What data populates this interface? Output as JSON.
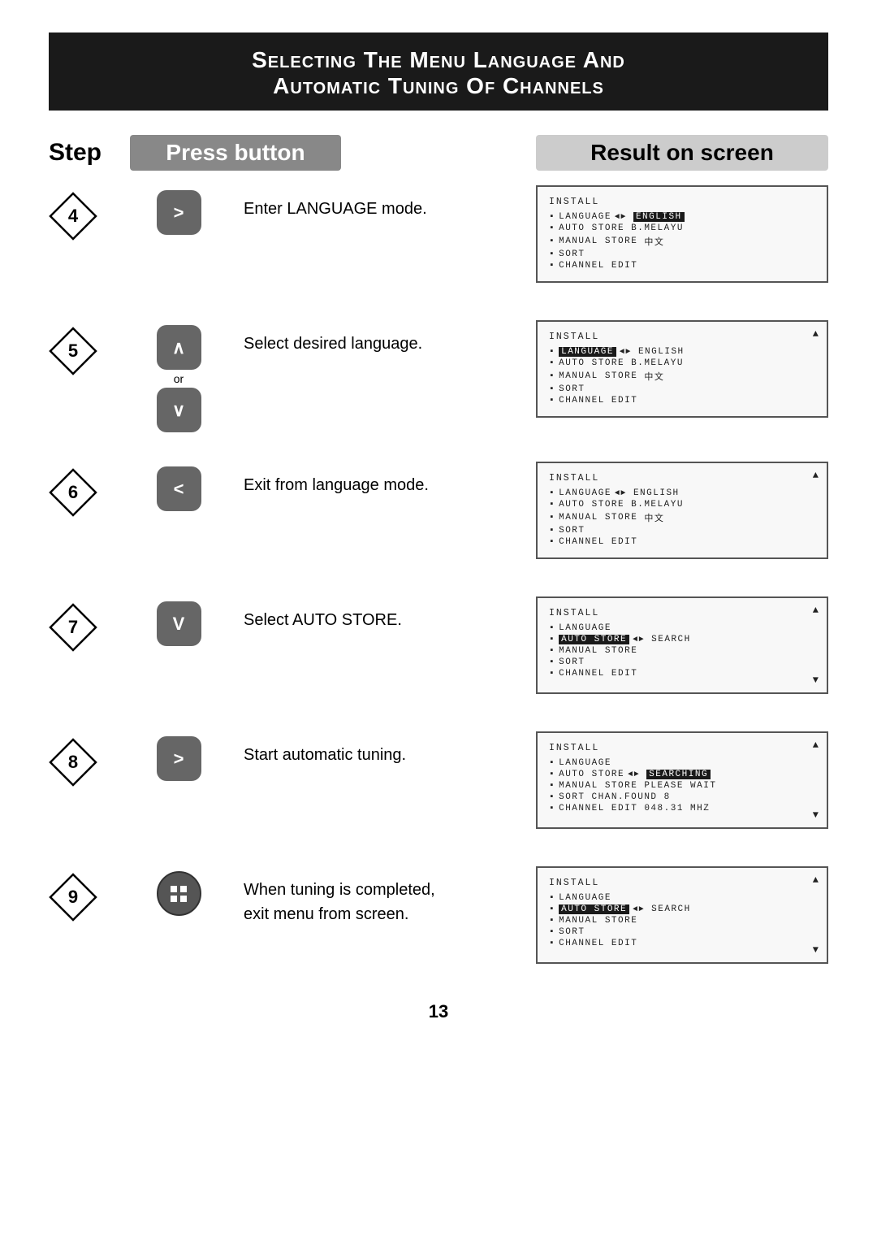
{
  "title": {
    "line1": "Selecting The Menu Language And",
    "line2": "Automatic Tuning Of Channels"
  },
  "headers": {
    "step": "Step",
    "press": "Press button",
    "result": "Result on screen"
  },
  "steps": [
    {
      "num": "4",
      "button": "right",
      "button_label": ">",
      "description": "Enter LANGUAGE mode.",
      "screen": {
        "title": "INSTALL",
        "arrow_up": false,
        "arrow_down": false,
        "rows": [
          {
            "bullet": true,
            "text": "LANGUAGE",
            "highlight": false,
            "right": "ENGLISH",
            "right_highlight": true,
            "arrow": true
          },
          {
            "bullet": true,
            "text": "AUTO STORE",
            "highlight": false,
            "right": "B.MELAYU",
            "right_highlight": false,
            "arrow": false
          },
          {
            "bullet": true,
            "text": "MANUAL STORE",
            "highlight": false,
            "right": "中文",
            "right_highlight": false,
            "arrow": false
          },
          {
            "bullet": true,
            "text": "SORT",
            "highlight": false,
            "right": "",
            "right_highlight": false,
            "arrow": false
          },
          {
            "bullet": true,
            "text": "CHANNEL EDIT",
            "highlight": false,
            "right": "",
            "right_highlight": false,
            "arrow": false
          }
        ]
      }
    },
    {
      "num": "5",
      "button": "up_down",
      "button_label_up": "∧",
      "button_label_down": "∨",
      "description": "Select desired language.",
      "screen": {
        "title": "INSTALL",
        "arrow_up": true,
        "arrow_down": false,
        "rows": [
          {
            "bullet": true,
            "text": "LANGUAGE",
            "highlight": true,
            "right": "ENGLISH",
            "right_highlight": false,
            "arrow": true
          },
          {
            "bullet": true,
            "text": "AUTO STORE",
            "highlight": false,
            "right": "B.MELAYU",
            "right_highlight": false,
            "arrow": false
          },
          {
            "bullet": true,
            "text": "MANUAL STORE",
            "highlight": false,
            "right": "中文",
            "right_highlight": false,
            "arrow": false
          },
          {
            "bullet": true,
            "text": "SORT",
            "highlight": false,
            "right": "",
            "right_highlight": false,
            "arrow": false
          },
          {
            "bullet": true,
            "text": "CHANNEL EDIT",
            "highlight": false,
            "right": "",
            "right_highlight": false,
            "arrow": false
          }
        ]
      }
    },
    {
      "num": "6",
      "button": "left",
      "button_label": "<",
      "description": "Exit from language mode.",
      "screen": {
        "title": "INSTALL",
        "arrow_up": true,
        "arrow_down": false,
        "rows": [
          {
            "bullet": true,
            "text": "LANGUAGE",
            "highlight": false,
            "right": "ENGLISH",
            "right_highlight": false,
            "arrow": true
          },
          {
            "bullet": true,
            "text": "AUTO STORE",
            "highlight": false,
            "right": "B.MELAYU",
            "right_highlight": false,
            "arrow": false
          },
          {
            "bullet": true,
            "text": "MANUAL STORE",
            "highlight": false,
            "right": "中文",
            "right_highlight": false,
            "arrow": false
          },
          {
            "bullet": true,
            "text": "SORT",
            "highlight": false,
            "right": "",
            "right_highlight": false,
            "arrow": false
          },
          {
            "bullet": true,
            "text": "CHANNEL EDIT",
            "highlight": false,
            "right": "",
            "right_highlight": false,
            "arrow": false
          }
        ]
      }
    },
    {
      "num": "7",
      "button": "down",
      "button_label": "V",
      "description": "Select AUTO STORE.",
      "screen": {
        "title": "INSTALL",
        "arrow_up": true,
        "arrow_down": true,
        "rows": [
          {
            "bullet": true,
            "text": "LANGUAGE",
            "highlight": false,
            "right": "",
            "right_highlight": false,
            "arrow": false
          },
          {
            "bullet": true,
            "text": "AUTO STORE",
            "highlight": true,
            "right": "SEARCH",
            "right_highlight": false,
            "arrow": true
          },
          {
            "bullet": true,
            "text": "MANUAL STORE",
            "highlight": false,
            "right": "",
            "right_highlight": false,
            "arrow": false
          },
          {
            "bullet": true,
            "text": "SORT",
            "highlight": false,
            "right": "",
            "right_highlight": false,
            "arrow": false
          },
          {
            "bullet": true,
            "text": "CHANNEL EDIT",
            "highlight": false,
            "right": "",
            "right_highlight": false,
            "arrow": false
          }
        ]
      }
    },
    {
      "num": "8",
      "button": "right",
      "button_label": ">",
      "description": "Start automatic tuning.",
      "screen": {
        "title": "INSTALL",
        "arrow_up": true,
        "arrow_down": true,
        "rows": [
          {
            "bullet": true,
            "text": "LANGUAGE",
            "highlight": false,
            "right": "",
            "right_highlight": false,
            "arrow": false
          },
          {
            "bullet": true,
            "text": "AUTO STORE",
            "highlight": false,
            "right": "SEARCHING",
            "right_highlight": true,
            "arrow": true
          },
          {
            "bullet": true,
            "text": "MANUAL STORE",
            "highlight": false,
            "right": "PLEASE WAIT",
            "right_highlight": false,
            "arrow": false
          },
          {
            "bullet": true,
            "text": "SORT",
            "highlight": false,
            "right": "CHAN.FOUND 8",
            "right_highlight": false,
            "arrow": false
          },
          {
            "bullet": true,
            "text": "CHANNEL EDIT",
            "highlight": false,
            "right": "048.31 MHZ",
            "right_highlight": false,
            "arrow": false
          }
        ]
      }
    },
    {
      "num": "9",
      "button": "menu",
      "button_label": "⊞",
      "description": "When tuning is completed,\nexit menu from screen.",
      "screen": {
        "title": "INSTALL",
        "arrow_up": true,
        "arrow_down": true,
        "rows": [
          {
            "bullet": true,
            "text": "LANGUAGE",
            "highlight": false,
            "right": "",
            "right_highlight": false,
            "arrow": false
          },
          {
            "bullet": true,
            "text": "AUTO STORE",
            "highlight": true,
            "right": "SEARCH",
            "right_highlight": false,
            "arrow": true
          },
          {
            "bullet": true,
            "text": "MANUAL STORE",
            "highlight": false,
            "right": "",
            "right_highlight": false,
            "arrow": false
          },
          {
            "bullet": true,
            "text": "SORT",
            "highlight": false,
            "right": "",
            "right_highlight": false,
            "arrow": false
          },
          {
            "bullet": true,
            "text": "CHANNEL EDIT",
            "highlight": false,
            "right": "",
            "right_highlight": false,
            "arrow": false
          }
        ]
      }
    }
  ],
  "page_number": "13"
}
